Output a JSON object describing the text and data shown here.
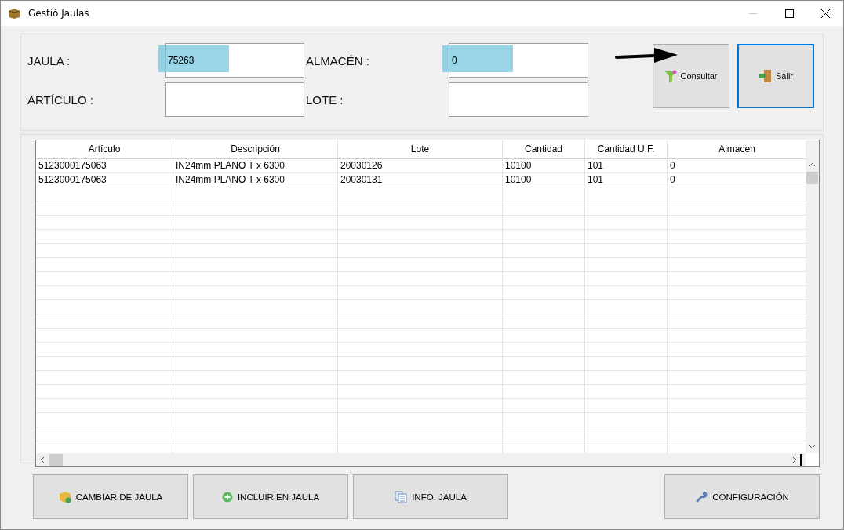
{
  "window": {
    "title": "Gestió Jaulas"
  },
  "fields": [
    {
      "label": "JAULA :",
      "value": "75263",
      "highlighted": true
    },
    {
      "label": "ALMACÉN :",
      "value": "0",
      "highlighted": true
    },
    {
      "label": "ARTÍCULO :",
      "highlighted": false
    },
    {
      "label": "LOTE :",
      "highlighted": false
    }
  ],
  "actions": [
    {
      "label": "Consultar",
      "kind": "filter",
      "focused": false,
      "arrow": true
    },
    {
      "label": "Salir",
      "kind": "exit",
      "focused": true,
      "arrow": false
    }
  ],
  "table": {
    "columns": [
      "Artículo",
      "Descripción",
      "Lote",
      "Cantidad",
      "Cantidad U.F.",
      "Almacen"
    ],
    "rows": [
      [
        "5123000175063",
        "IN24mm PLANO T x 6300",
        "20030126",
        "10100",
        "101",
        "0"
      ],
      [
        "5123000175063",
        "IN24mm PLANO T x 6300",
        "20030131",
        "10100",
        "101",
        "0"
      ]
    ]
  },
  "bottom_buttons": [
    {
      "label": "CAMBIAR DE JAULA",
      "kind": "box"
    },
    {
      "label": "INCLUIR EN JAULA",
      "kind": "add"
    },
    {
      "label": "INFO. JAULA",
      "kind": "info"
    },
    {
      "label": "CONFIGURACIÓN",
      "kind": "wrench"
    }
  ]
}
